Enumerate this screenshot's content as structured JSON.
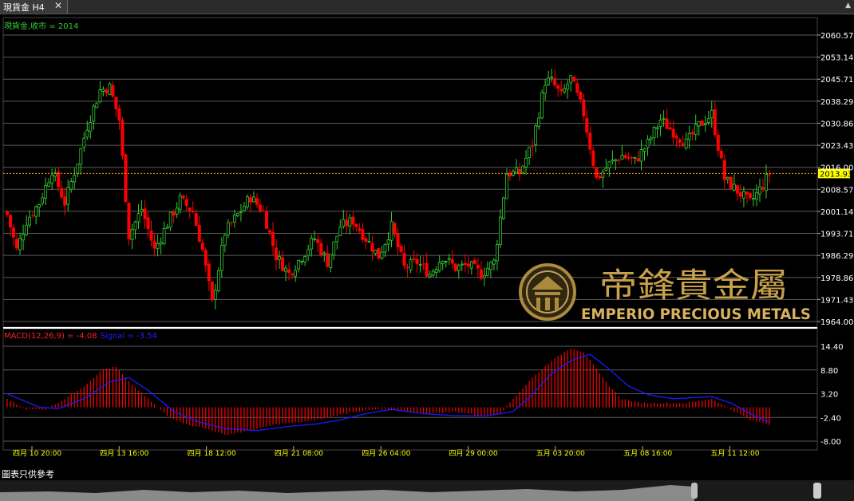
{
  "window": {
    "tab_title": "現貨金 H4",
    "close_glyph": "✕",
    "scroll_glyph": "▲"
  },
  "main": {
    "close_label": "現貨金,收市 = 2014",
    "price_ticks": [
      "2060.57",
      "2053.14",
      "2045.71",
      "2038.29",
      "2030.86",
      "2023.43",
      "2016.00",
      "2008.57",
      "2001.14",
      "1993.71",
      "1986.29",
      "1978.86",
      "1971.43",
      "1964.00"
    ],
    "current_price": "2013.93",
    "current_price_value": 2013.93,
    "price_range": [
      1964.0,
      2060.57
    ]
  },
  "macd": {
    "label_main": "MACD(12,26,9) = -4.08",
    "label_signal": "Signal = -3.54",
    "ticks": [
      "14.40",
      "8.80",
      "3.20",
      "-2.40",
      "-8.00"
    ],
    "range": [
      -8.0,
      14.4
    ]
  },
  "time_labels": [
    "四月 10 20:00",
    "四月 13 16:00",
    "四月 18 12:00",
    "四月 21 08:00",
    "四月 26 04:00",
    "四月 29 00:00",
    "五月 03 20:00",
    "五月 08 16:00",
    "五月 11 12:00"
  ],
  "watermark": {
    "cn": "帝鋒貴金屬",
    "en": "EMPERIO PRECIOUS METALS"
  },
  "footer": {
    "note": "圖表只供參考"
  },
  "colors": {
    "up": "#33cc33",
    "down": "#ff0000",
    "signal": "#1a1aff",
    "macd_hist": "#ff0000",
    "grid": "#5a5a5a",
    "axis_text": "#ffffff",
    "time_text": "#ffff00",
    "current_price_bg": "#ffff00",
    "close_label": "#33cc33",
    "watermark_gold": "#c9a14a"
  },
  "chart_data": {
    "type": "candlestick",
    "price_axis": {
      "min": 1964.0,
      "max": 2060.57
    },
    "close_anchors": [
      [
        0,
        2000
      ],
      [
        3,
        1988
      ],
      [
        6,
        1998
      ],
      [
        10,
        2004
      ],
      [
        14,
        2015
      ],
      [
        18,
        2004
      ],
      [
        22,
        2018
      ],
      [
        25,
        2030
      ],
      [
        29,
        2042
      ],
      [
        32,
        2043
      ],
      [
        35,
        2032
      ],
      [
        38,
        1993
      ],
      [
        42,
        2002
      ],
      [
        46,
        1988
      ],
      [
        50,
        1997
      ],
      [
        54,
        2005
      ],
      [
        58,
        2001
      ],
      [
        61,
        1988
      ],
      [
        64,
        1970
      ],
      [
        68,
        1994
      ],
      [
        72,
        2000
      ],
      [
        76,
        2006
      ],
      [
        80,
        2001
      ],
      [
        84,
        1986
      ],
      [
        88,
        1980
      ],
      [
        92,
        1986
      ],
      [
        96,
        1992
      ],
      [
        100,
        1984
      ],
      [
        104,
        1996
      ],
      [
        108,
        1998
      ],
      [
        112,
        1992
      ],
      [
        116,
        1986
      ],
      [
        120,
        1996
      ],
      [
        124,
        1982
      ],
      [
        128,
        1984
      ],
      [
        132,
        1980
      ],
      [
        136,
        1986
      ],
      [
        140,
        1982
      ],
      [
        144,
        1983
      ],
      [
        148,
        1980
      ],
      [
        152,
        1984
      ],
      [
        156,
        2014
      ],
      [
        160,
        2014
      ],
      [
        164,
        2024
      ],
      [
        168,
        2045
      ],
      [
        170,
        2045
      ],
      [
        173,
        2040
      ],
      [
        176,
        2046
      ],
      [
        180,
        2034
      ],
      [
        184,
        2012
      ],
      [
        188,
        2017
      ],
      [
        192,
        2020
      ],
      [
        196,
        2018
      ],
      [
        200,
        2024
      ],
      [
        204,
        2032
      ],
      [
        208,
        2028
      ],
      [
        212,
        2024
      ],
      [
        216,
        2030
      ],
      [
        220,
        2034
      ],
      [
        224,
        2012
      ],
      [
        228,
        2008
      ],
      [
        232,
        2004
      ],
      [
        236,
        2010
      ],
      [
        238,
        2014
      ]
    ],
    "macd_anchors": [
      [
        0,
        2.0
      ],
      [
        6,
        -0.5
      ],
      [
        12,
        -0.5
      ],
      [
        18,
        2
      ],
      [
        24,
        5
      ],
      [
        30,
        9
      ],
      [
        34,
        9.5
      ],
      [
        38,
        6
      ],
      [
        44,
        2
      ],
      [
        50,
        -2
      ],
      [
        56,
        -4
      ],
      [
        62,
        -5
      ],
      [
        68,
        -6.5
      ],
      [
        76,
        -5.5
      ],
      [
        84,
        -4
      ],
      [
        92,
        -3.5
      ],
      [
        100,
        -2.5
      ],
      [
        108,
        -1
      ],
      [
        116,
        -0.5
      ],
      [
        124,
        -1
      ],
      [
        132,
        -1.5
      ],
      [
        140,
        -1
      ],
      [
        148,
        -2
      ],
      [
        154,
        -1.5
      ],
      [
        158,
        2
      ],
      [
        164,
        7
      ],
      [
        170,
        11
      ],
      [
        176,
        14
      ],
      [
        180,
        13
      ],
      [
        184,
        9
      ],
      [
        188,
        5
      ],
      [
        192,
        2
      ],
      [
        198,
        1
      ],
      [
        204,
        1
      ],
      [
        212,
        1
      ],
      [
        220,
        2
      ],
      [
        226,
        -0.5
      ],
      [
        232,
        -3
      ],
      [
        238,
        -4.08
      ]
    ],
    "signal_anchors": [
      [
        0,
        3.2
      ],
      [
        10,
        0
      ],
      [
        16,
        -0.3
      ],
      [
        24,
        2
      ],
      [
        32,
        6
      ],
      [
        38,
        7
      ],
      [
        44,
        4
      ],
      [
        52,
        -1
      ],
      [
        60,
        -3.5
      ],
      [
        68,
        -5
      ],
      [
        78,
        -5.5
      ],
      [
        88,
        -4.5
      ],
      [
        96,
        -4
      ],
      [
        104,
        -3
      ],
      [
        112,
        -1.5
      ],
      [
        120,
        -0.5
      ],
      [
        130,
        -1.5
      ],
      [
        140,
        -2
      ],
      [
        150,
        -2
      ],
      [
        158,
        -1
      ],
      [
        164,
        3
      ],
      [
        170,
        8
      ],
      [
        176,
        11
      ],
      [
        182,
        12.5
      ],
      [
        188,
        9
      ],
      [
        194,
        5
      ],
      [
        200,
        3
      ],
      [
        208,
        2
      ],
      [
        220,
        2.5
      ],
      [
        226,
        1
      ],
      [
        232,
        -1.5
      ],
      [
        238,
        -3.54
      ]
    ],
    "macd_axis": {
      "min": -8.0,
      "max": 14.4
    },
    "x_labels": [
      "四月 10 20:00",
      "四月 13 16:00",
      "四月 18 12:00",
      "四月 21 08:00",
      "四月 26 04:00",
      "四月 29 00:00",
      "五月 03 20:00",
      "五月 08 16:00",
      "五月 11 12:00"
    ],
    "grid": true
  }
}
